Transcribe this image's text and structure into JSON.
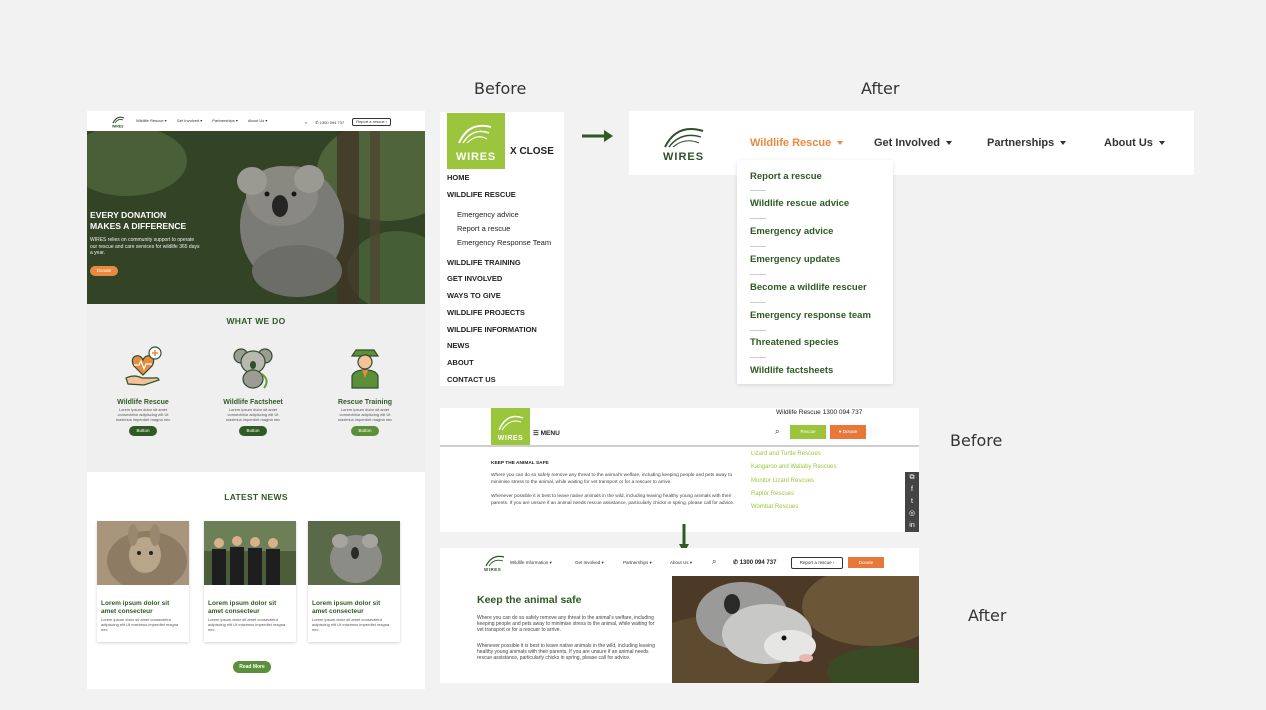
{
  "captions": {
    "before_top": "Before",
    "after_top": "After",
    "before_right": "Before",
    "after_right": "After"
  },
  "left_page": {
    "nav_links": [
      "Wildlife Rescue ▾",
      "Get Involved ▾",
      "Partnerships ▾",
      "About Us ▾"
    ],
    "phone": "1300 094 737",
    "report_button": "Report a rescue ›",
    "hero_title_1": "EVERY DONATION",
    "hero_title_2": "MAKES A DIFFERENCE",
    "hero_text": "WIRES relies on community support to operate our rescue and care services for wildlife 365 days a year.",
    "donate_button": "Donate",
    "what_we_do_title": "WHAT WE DO",
    "services": [
      {
        "title": "Wildlife Rescue",
        "desc": "Lorem ipsum dolor sit amet consectetur adipiscing elit Ut maximus imperdiet magna nec",
        "button": "Button"
      },
      {
        "title": "Wildlife Factsheet",
        "desc": "Lorem ipsum dolor sit amet consectetur adipiscing elit Ut maximus imperdiet magna nec",
        "button": "Button"
      },
      {
        "title": "Rescue Training",
        "desc": "Lorem ipsum dolor sit amet consectetur adipiscing elit Ut maximus imperdiet magna nec",
        "button": "Button"
      }
    ],
    "latest_news_title": "LATEST NEWS",
    "news": [
      {
        "title": "Lorem ipsum dolor sit amet consecteur",
        "desc": "Lorem ipsum dolor sit amet consectetur adipiscing elit Ut maximus imperdiet magna nec"
      },
      {
        "title": "Lorem ipsum dolor sit amet consecteur",
        "desc": "Lorem ipsum dolor sit amet consectetur adipiscing elit Ut maximus imperdiet magna nec"
      },
      {
        "title": "Lorem ipsum dolor sit amet consecteur",
        "desc": "Lorem ipsum dolor sit amet consectetur adipiscing elit Ut maximus imperdiet magna nec"
      }
    ],
    "read_more": "Read More"
  },
  "menu_before": {
    "logo_text": "WIRES",
    "close": "X CLOSE",
    "items": [
      "HOME",
      "WILDLIFE RESCUE"
    ],
    "sub_items": [
      "Emergency advice",
      "Report a rescue",
      "Emergency Response Team"
    ],
    "items_after": [
      "WILDLIFE TRAINING",
      "GET INVOLVED",
      "WAYS TO GIVE",
      "WILDLIFE PROJECTS",
      "WILDLIFE INFORMATION",
      "NEWS",
      "ABOUT",
      "CONTACT US"
    ]
  },
  "nav_after": {
    "logo_text": "WIRES",
    "items": [
      "Wildlife Rescue",
      "Get Involved",
      "Partnerships",
      "About Us"
    ],
    "dropdown": [
      "Report a rescue",
      "Wildlife rescue advice",
      "Emergency advice",
      "Emergency updates",
      "Become a wildlife rescuer",
      "Emergency response team",
      "Threatened species",
      "Wildlife factsheets"
    ]
  },
  "article_before": {
    "logo_text": "WIRES",
    "menu": "☰ MENU",
    "phone": "Wildlife Rescue 1300 094 737",
    "rescue_button": "Rescue",
    "donate_button": "♥ Donate",
    "heading": "KEEP THE ANIMAL SAFE",
    "para1": "Where you can do so safely remove any threat to the animal's welfare, including keeping people and pets away to minimise stress to the animal, while waiting for vet transport or for a rescuer to arrive.",
    "para2": "Whenever possible it is best to leave native animals in the wild, including leaving healthy young animals with their parents. If you are unsure if an animal needs rescue assistance, particularly chicks in spring, please call for advice.",
    "links": [
      "Lizard and Turtle Rescues",
      "Kangaroo and Wallaby Rescues",
      "Monitor Lizard Rescues",
      "Raptor Rescues",
      "Wombat Rescues"
    ]
  },
  "article_after": {
    "logo_text": "WIRES",
    "nav": [
      "Wildlife Information ▾",
      "Get Involved ▾",
      "Partnerships ▾",
      "About Us ▾"
    ],
    "phone": "1300 094 737",
    "report_button": "Report a rescue ›",
    "donate_button": "Donate",
    "title": "Keep the animal safe",
    "para1": "Where you can do so safely remove any threat to the animal's welfare, including keeping people and pets away to minimise stress to the animal, while waiting for vet transport or for a rescuer to arrive.",
    "para2": "Whenever possible it is best to leave native animals in the wild, including leaving healthy young animals with their parents. If you are unsure if an animal needs rescue assistance, particularly chicks in spring, please call for advice."
  },
  "colors": {
    "brand_green": "#2f5a24",
    "lime_green": "#9bc53d",
    "accent_orange": "#e88a3f",
    "background": "#f2f2f2"
  }
}
